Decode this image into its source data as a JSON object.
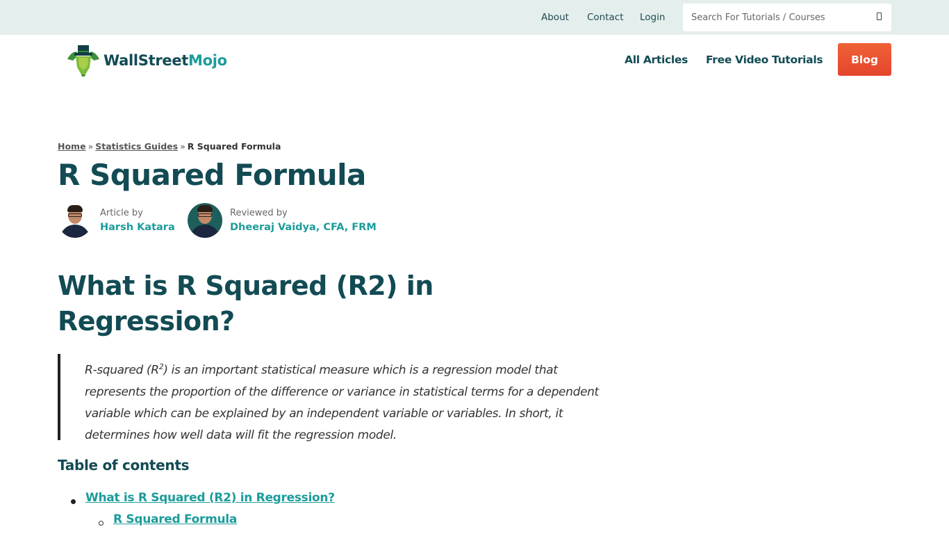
{
  "topbar": {
    "links": [
      "About",
      "Contact",
      "Login"
    ],
    "search": {
      "placeholder": "Search For Tutorials / Courses",
      "value": "",
      "icon": "search-icon"
    }
  },
  "header": {
    "logo": {
      "text_part1": "WallStreet",
      "text_part2": "Mojo",
      "icon": "bull-mascot-logo"
    },
    "nav": [
      "All Articles",
      "Free Video Tutorials"
    ],
    "blog_button": "Blog"
  },
  "breadcrumb": {
    "items": [
      "Home",
      "Statistics Guides"
    ],
    "separator": "»",
    "current": "R Squared Formula"
  },
  "article": {
    "title": "R Squared Formula",
    "author": {
      "role": "Article by",
      "name": "Harsh Katara"
    },
    "reviewer": {
      "role": "Reviewed by",
      "name": "Dheeraj Vaidya, CFA, FRM"
    },
    "section_heading": "What is R Squared (R2) in Regression?",
    "quote": {
      "prefix": "R-squared (R",
      "sup": "2",
      "suffix": ") is an important statistical measure which is a regression model that represents the proportion of the difference or variance in statistical terms for a dependent variable which can be explained by an independent variable or variables. In short, it determines how well data will fit the regression model."
    }
  },
  "toc": {
    "title": "Table of contents",
    "items": [
      {
        "label": "What is R Squared (R2) in Regression?",
        "level": 1
      },
      {
        "label": "R Squared Formula",
        "level": 2
      }
    ]
  },
  "colors": {
    "primary_dark": "#124b54",
    "accent_teal": "#1c9c9b",
    "blog_orange": "#e9532f",
    "topbar_bg": "#e4eeed"
  }
}
